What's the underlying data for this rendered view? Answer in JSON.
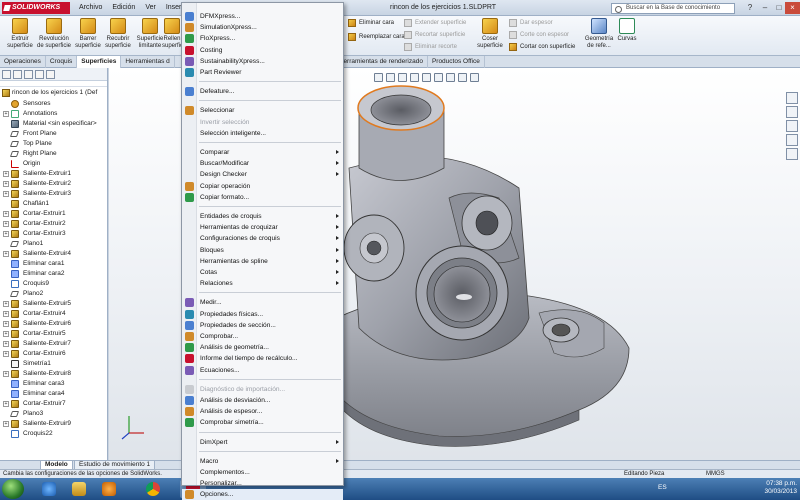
{
  "app": {
    "logo_text": "SOLIDWORKS",
    "document_title": "rincon de los ejercicios 1.SLDPRT",
    "menubar": [
      "Archivo",
      "Edición",
      "Ver",
      "Insertar"
    ],
    "search_placeholder": "Buscar en la Base de conocimiento"
  },
  "ribbon": {
    "big_buttons": [
      {
        "label": "Extruir\nsuperficie"
      },
      {
        "label": "Revolución\nde superficie"
      },
      {
        "label": "Barrer\nsuperficie"
      },
      {
        "label": "Recubrir\nsuperficie"
      },
      {
        "label": "Superficie\nlimitante"
      },
      {
        "label": "Rellen\nsuperfici"
      }
    ],
    "small_buttons": [
      {
        "label": "Eliminar cara",
        "enabled": true
      },
      {
        "label": "Reemplazar cara",
        "enabled": true
      },
      {
        "label": "Extender superficie",
        "enabled": false
      },
      {
        "label": "Recortar superficie",
        "enabled": false
      },
      {
        "label": "Eliminar recorte",
        "enabled": false
      },
      {
        "label": "Dar espesor",
        "enabled": false
      },
      {
        "label": "Corte con espesor",
        "enabled": false
      },
      {
        "label": "Cortar con superficie",
        "enabled": true
      }
    ],
    "coser_label": "Coser\nsuperficie",
    "geometria_label": "Geometría\nde refe...",
    "curvas_label": "Curvas"
  },
  "tabs": [
    {
      "label": "Operaciones",
      "active": false
    },
    {
      "label": "Croquis",
      "active": false
    },
    {
      "label": "Superficies",
      "active": true
    },
    {
      "label": "Herramientas d",
      "active": false
    },
    {
      "label": "Herramientas de renderizado",
      "active": false
    },
    {
      "label": "Productos Office",
      "active": false
    }
  ],
  "tree": {
    "root_label": "rincon de los ejercicios 1  (Def",
    "items": [
      {
        "label": "Sensores",
        "icon": "sensor-icon",
        "kind": "sens",
        "expand": ""
      },
      {
        "label": "Annotations",
        "icon": "annotations-icon",
        "kind": "ann",
        "expand": "+"
      },
      {
        "label": "Material <sin especificar>",
        "icon": "material-icon",
        "kind": "mat",
        "expand": ""
      },
      {
        "label": "Front Plane",
        "icon": "plane-icon",
        "kind": "plane",
        "expand": ""
      },
      {
        "label": "Top Plane",
        "icon": "plane-icon",
        "kind": "plane",
        "expand": ""
      },
      {
        "label": "Right Plane",
        "icon": "plane-icon",
        "kind": "plane",
        "expand": ""
      },
      {
        "label": "Origin",
        "icon": "origin-icon",
        "kind": "origin",
        "expand": ""
      },
      {
        "label": "Saliente-Extruir1",
        "icon": "extrude-icon",
        "kind": "feat",
        "expand": "+"
      },
      {
        "label": "Saliente-Extruir2",
        "icon": "extrude-icon",
        "kind": "feat",
        "expand": "+"
      },
      {
        "label": "Saliente-Extruir3",
        "icon": "extrude-icon",
        "kind": "feat",
        "expand": "+"
      },
      {
        "label": "Chaflán1",
        "icon": "chamfer-icon",
        "kind": "feat",
        "expand": ""
      },
      {
        "label": "Cortar-Extruir1",
        "icon": "cut-icon",
        "kind": "cut",
        "expand": "+"
      },
      {
        "label": "Cortar-Extruir2",
        "icon": "cut-icon",
        "kind": "cut",
        "expand": "+"
      },
      {
        "label": "Cortar-Extruir3",
        "icon": "cut-icon",
        "kind": "cut",
        "expand": "+"
      },
      {
        "label": "Plano1",
        "icon": "plane-icon",
        "kind": "plane",
        "expand": ""
      },
      {
        "label": "Saliente-Extruir4",
        "icon": "extrude-icon",
        "kind": "feat",
        "expand": "+"
      },
      {
        "label": "Eliminar cara1",
        "icon": "delete-face-icon",
        "kind": "fill",
        "expand": ""
      },
      {
        "label": "Eliminar cara2",
        "icon": "delete-face-icon",
        "kind": "fill",
        "expand": ""
      },
      {
        "label": "Croquis9",
        "icon": "sketch-icon",
        "kind": "sketch",
        "expand": ""
      },
      {
        "label": "Plano2",
        "icon": "plane-icon",
        "kind": "plane",
        "expand": ""
      },
      {
        "label": "Saliente-Extruir5",
        "icon": "extrude-icon",
        "kind": "feat",
        "expand": "+"
      },
      {
        "label": "Cortar-Extruir4",
        "icon": "cut-icon",
        "kind": "cut",
        "expand": "+"
      },
      {
        "label": "Saliente-Extruir6",
        "icon": "extrude-icon",
        "kind": "feat",
        "expand": "+"
      },
      {
        "label": "Cortar-Extruir5",
        "icon": "cut-icon",
        "kind": "cut",
        "expand": "+"
      },
      {
        "label": "Saliente-Extruir7",
        "icon": "extrude-icon",
        "kind": "feat",
        "expand": "+"
      },
      {
        "label": "Cortar-Extruir6",
        "icon": "cut-icon",
        "kind": "cut",
        "expand": "+"
      },
      {
        "label": "Simetría1",
        "icon": "mirror-icon",
        "kind": "sym",
        "expand": ""
      },
      {
        "label": "Saliente-Extruir8",
        "icon": "extrude-icon",
        "kind": "feat",
        "expand": "+"
      },
      {
        "label": "Eliminar cara3",
        "icon": "delete-face-icon",
        "kind": "fill",
        "expand": ""
      },
      {
        "label": "Eliminar cara4",
        "icon": "delete-face-icon",
        "kind": "fill",
        "expand": ""
      },
      {
        "label": "Cortar-Extruir7",
        "icon": "cut-icon",
        "kind": "cut",
        "expand": "+"
      },
      {
        "label": "Plano3",
        "icon": "plane-icon",
        "kind": "plane",
        "expand": ""
      },
      {
        "label": "Saliente-Extruir9",
        "icon": "extrude-icon",
        "kind": "feat",
        "expand": "+"
      },
      {
        "label": "Croquis22",
        "icon": "sketch-icon",
        "kind": "sketch",
        "expand": ""
      }
    ]
  },
  "bottom_tabs": [
    {
      "label": "Modelo",
      "active": true
    },
    {
      "label": "Estudio de movimiento 1",
      "active": false
    }
  ],
  "status": {
    "message": "Cambia las configuraciones de las opciones de SolidWorks.",
    "mode": "Editando Pieza",
    "units": "MMGS"
  },
  "menu": {
    "items": [
      {
        "label": "DFMXpress...",
        "enabled": true,
        "submenu": false,
        "icon": "dfmxpress-icon",
        "gap_before": false
      },
      {
        "label": "SimulationXpress...",
        "enabled": true,
        "submenu": false,
        "icon": "simulationxpress-icon",
        "gap_before": false
      },
      {
        "label": "FloXpress...",
        "enabled": true,
        "submenu": false,
        "icon": "floxpress-icon",
        "gap_before": false
      },
      {
        "label": "Costing",
        "enabled": true,
        "submenu": false,
        "icon": "costing-icon",
        "gap_before": false
      },
      {
        "label": "SustainabilityXpress...",
        "enabled": true,
        "submenu": false,
        "icon": "sustainability-icon",
        "gap_before": false
      },
      {
        "label": "Part Reviewer",
        "enabled": true,
        "submenu": false,
        "icon": "part-reviewer-icon",
        "gap_before": false
      },
      {
        "label": "Defeature...",
        "enabled": true,
        "submenu": false,
        "icon": "defeature-icon",
        "gap_before": true
      },
      {
        "label": "Seleccionar",
        "enabled": true,
        "submenu": false,
        "icon": "select-icon",
        "gap_before": true
      },
      {
        "label": "Invertir selección",
        "enabled": false,
        "submenu": false,
        "icon": "",
        "gap_before": false
      },
      {
        "label": "Selección inteligente...",
        "enabled": true,
        "submenu": false,
        "icon": "",
        "gap_before": false
      },
      {
        "label": "Comparar",
        "enabled": true,
        "submenu": true,
        "icon": "",
        "gap_before": true
      },
      {
        "label": "Buscar/Modificar",
        "enabled": true,
        "submenu": true,
        "icon": "",
        "gap_before": false
      },
      {
        "label": "Design Checker",
        "enabled": true,
        "submenu": true,
        "icon": "",
        "gap_before": false
      },
      {
        "label": "Copiar operación",
        "enabled": true,
        "submenu": false,
        "icon": "copy-feature-icon",
        "gap_before": false
      },
      {
        "label": "Copiar formato...",
        "enabled": true,
        "submenu": false,
        "icon": "copy-format-icon",
        "gap_before": false
      },
      {
        "label": "Entidades de croquis",
        "enabled": true,
        "submenu": true,
        "icon": "",
        "gap_before": true
      },
      {
        "label": "Herramientas de croquizar",
        "enabled": true,
        "submenu": true,
        "icon": "",
        "gap_before": false
      },
      {
        "label": "Configuraciones de croquis",
        "enabled": true,
        "submenu": true,
        "icon": "",
        "gap_before": false
      },
      {
        "label": "Bloques",
        "enabled": true,
        "submenu": true,
        "icon": "",
        "gap_before": false
      },
      {
        "label": "Herramientas de spline",
        "enabled": true,
        "submenu": true,
        "icon": "",
        "gap_before": false
      },
      {
        "label": "Cotas",
        "enabled": true,
        "submenu": true,
        "icon": "",
        "gap_before": false
      },
      {
        "label": "Relaciones",
        "enabled": true,
        "submenu": true,
        "icon": "",
        "gap_before": false
      },
      {
        "label": "Medir...",
        "enabled": true,
        "submenu": false,
        "icon": "measure-icon",
        "gap_before": true
      },
      {
        "label": "Propiedades físicas...",
        "enabled": true,
        "submenu": false,
        "icon": "mass-properties-icon",
        "gap_before": false
      },
      {
        "label": "Propiedades de sección...",
        "enabled": true,
        "submenu": false,
        "icon": "section-properties-icon",
        "gap_before": false
      },
      {
        "label": "Comprobar...",
        "enabled": true,
        "submenu": false,
        "icon": "check-icon",
        "gap_before": false
      },
      {
        "label": "Análisis de geometría...",
        "enabled": true,
        "submenu": false,
        "icon": "geometry-analysis-icon",
        "gap_before": false
      },
      {
        "label": "Informe del tiempo de recálculo...",
        "enabled": true,
        "submenu": false,
        "icon": "rebuild-time-icon",
        "gap_before": false
      },
      {
        "label": "Ecuaciones...",
        "enabled": true,
        "submenu": false,
        "icon": "equations-icon",
        "gap_before": false
      },
      {
        "label": "Diagnóstico de importación...",
        "enabled": false,
        "submenu": false,
        "icon": "import-diagnostics-icon",
        "gap_before": true
      },
      {
        "label": "Análisis de desviación...",
        "enabled": true,
        "submenu": false,
        "icon": "deviation-icon",
        "gap_before": false
      },
      {
        "label": "Análisis de espesor...",
        "enabled": true,
        "submenu": false,
        "icon": "thickness-icon",
        "gap_before": false
      },
      {
        "label": "Comprobar simetría...",
        "enabled": true,
        "submenu": false,
        "icon": "symmetry-check-icon",
        "gap_before": false
      },
      {
        "label": "DimXpert",
        "enabled": true,
        "submenu": true,
        "icon": "",
        "gap_before": true
      },
      {
        "label": "Macro",
        "enabled": true,
        "submenu": true,
        "icon": "",
        "gap_before": true
      },
      {
        "label": "Complementos...",
        "enabled": true,
        "submenu": false,
        "icon": "",
        "gap_before": false
      },
      {
        "label": "Personalizar...",
        "enabled": true,
        "submenu": false,
        "icon": "",
        "gap_before": false
      },
      {
        "label": "Opciones...",
        "enabled": true,
        "submenu": false,
        "icon": "options-icon",
        "gap_before": false,
        "highlighted": true
      }
    ]
  },
  "taskbar": {
    "language": "ES",
    "time": "07:38 p.m.",
    "date": "30/03/2013"
  },
  "colors": {
    "accent": "#c8102e",
    "menu_bg": "#f6f7f9",
    "model_gray": "#a0a3ac",
    "model_edge_orange": "#e07a1f"
  }
}
